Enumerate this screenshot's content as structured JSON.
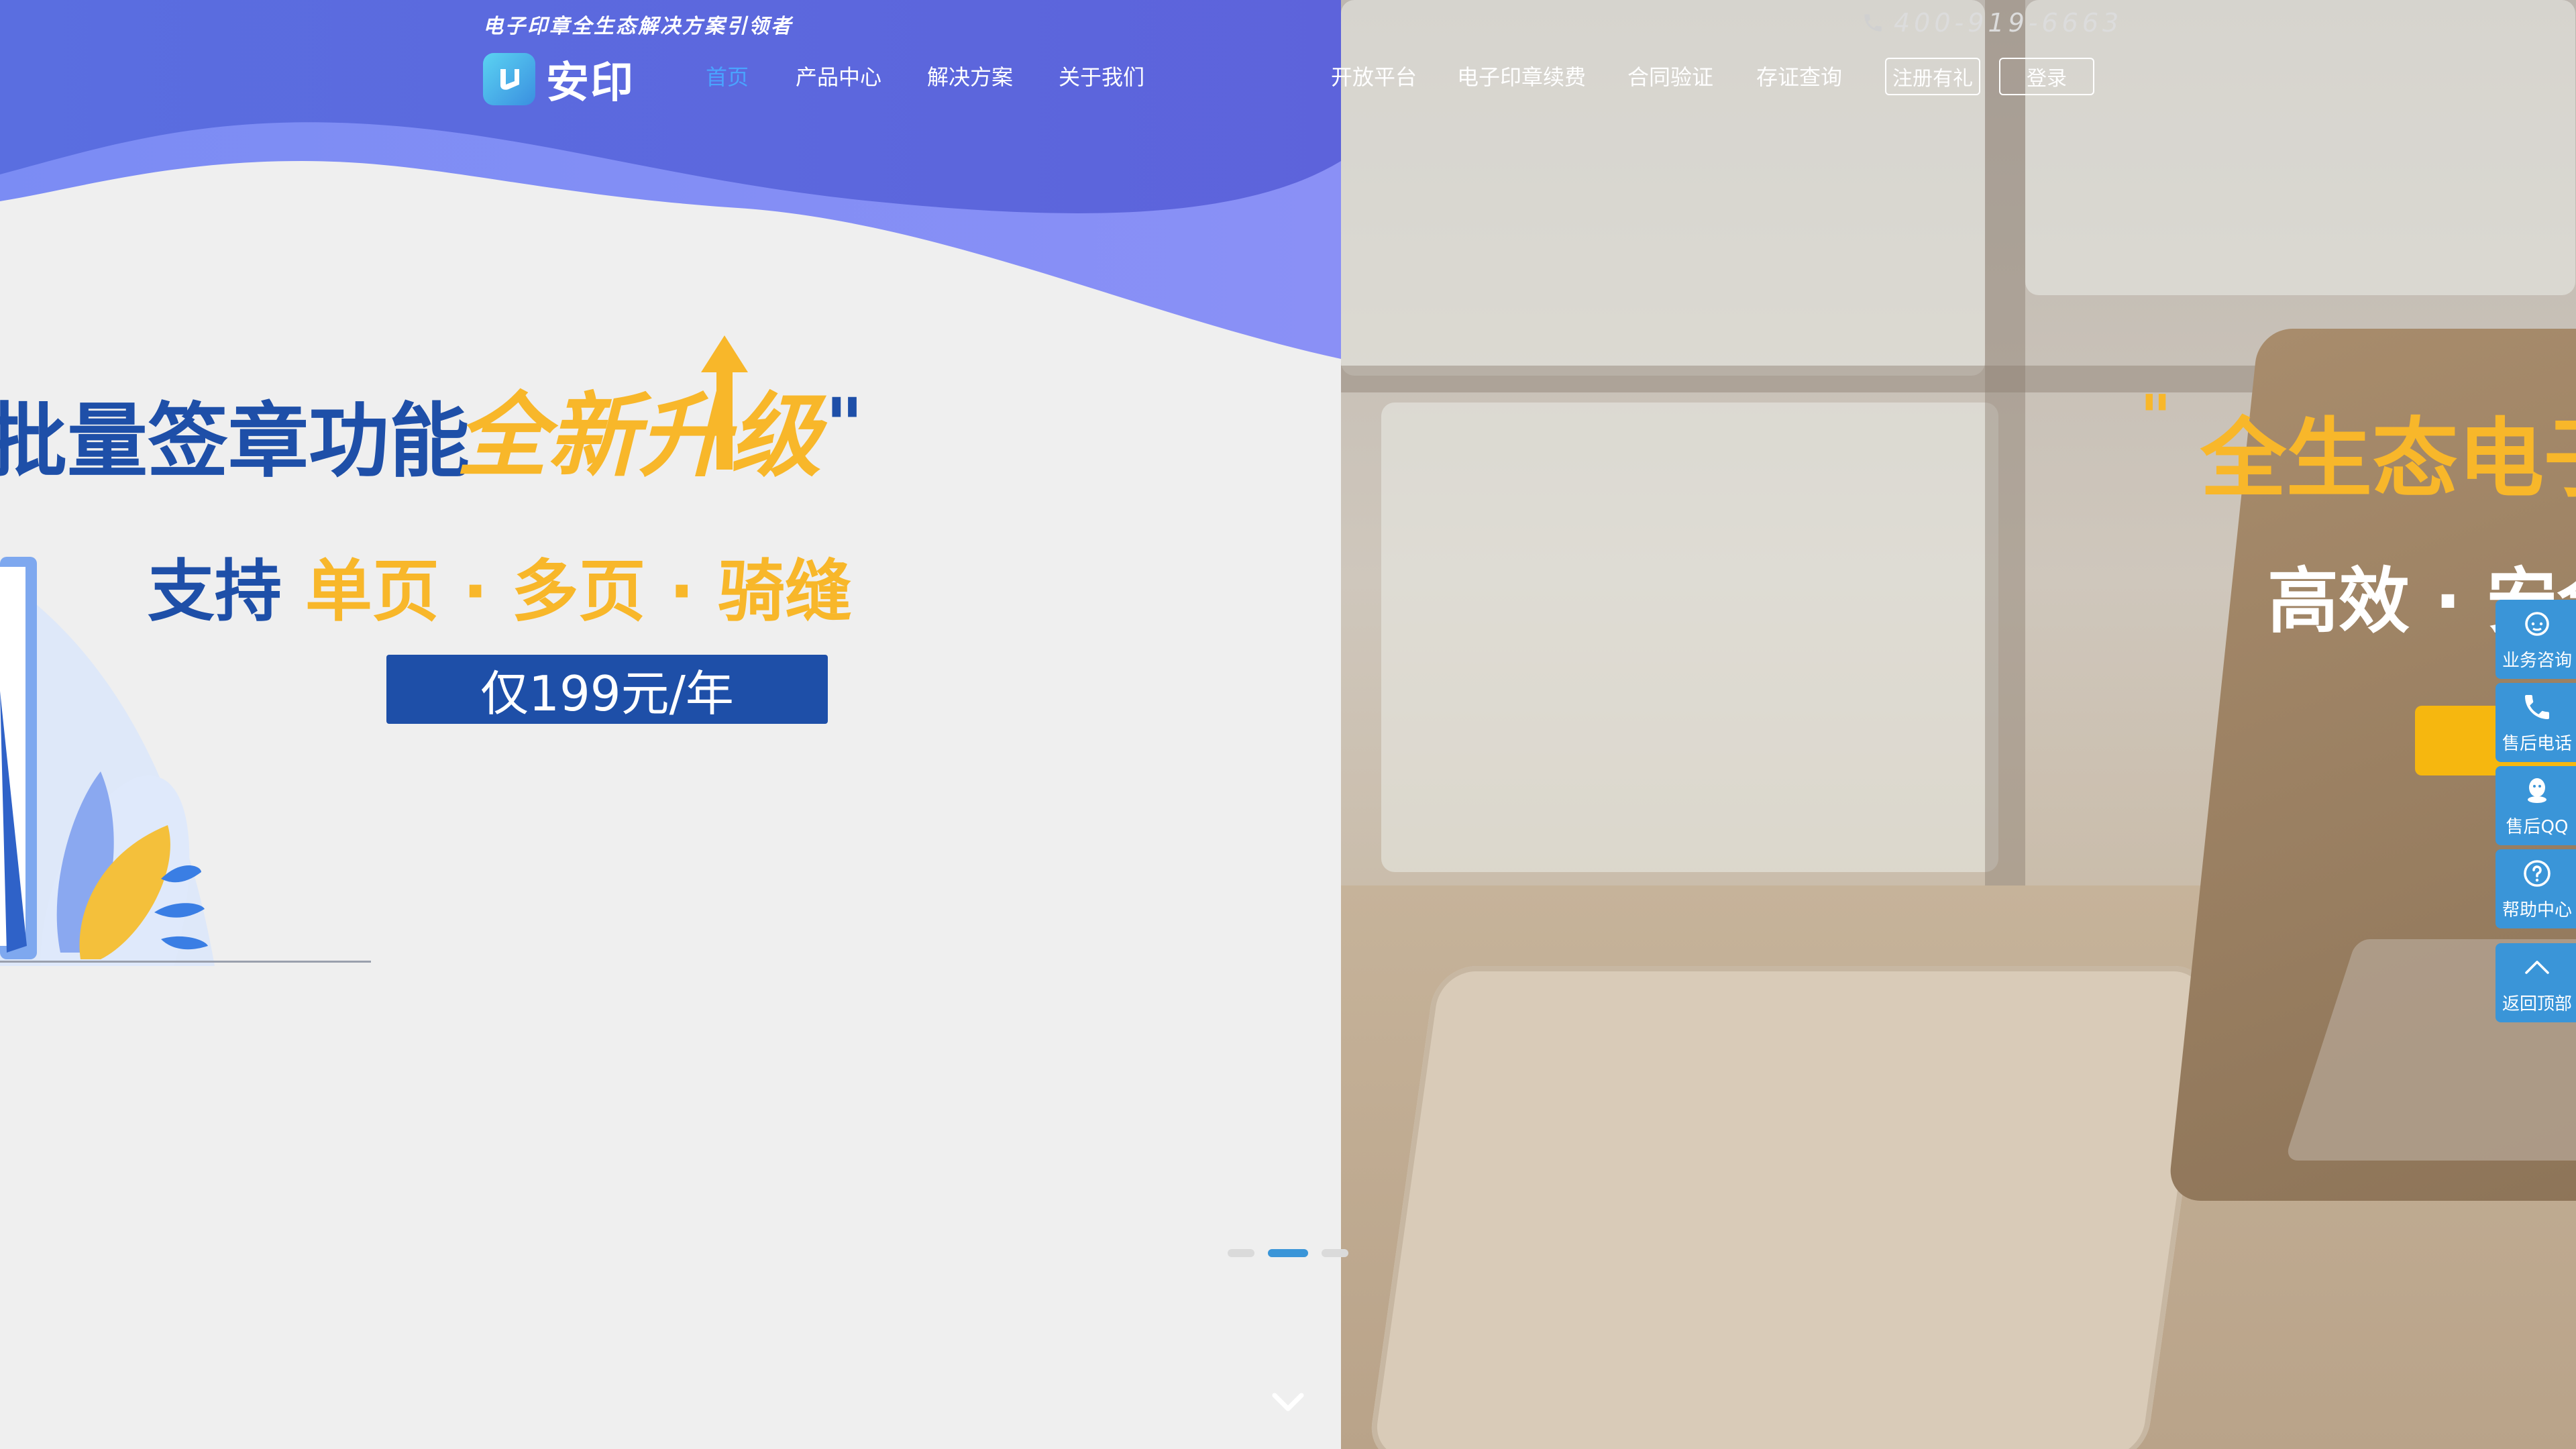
{
  "header": {
    "tagline": "电子印章全生态解决方案引领者",
    "phone": "400-919-6663",
    "logo_text": "安印",
    "nav_left": [
      "首页",
      "产品中心",
      "解决方案",
      "关于我们"
    ],
    "nav_right": [
      "开放平台",
      "电子印章续费",
      "合同验证",
      "存证查询"
    ],
    "register_label": "注册有礼",
    "login_label": "登录"
  },
  "slides": {
    "left": {
      "headline_main": "批量签章功能",
      "headline_accent": "全新升级",
      "quote_close": "\"",
      "sub_prefix": "支持",
      "sub_accent": "单页 · 多页 · 骑缝",
      "price": "仅199元/年"
    },
    "right": {
      "quote_open": "\"",
      "headline": "全生态电子",
      "sub": "高效 · 安全"
    }
  },
  "carousel": {
    "dot_count": 3,
    "active_index": 1
  },
  "float_bar": {
    "items": [
      "业务咨询",
      "售后电话",
      "售后QQ",
      "帮助中心",
      "返回顶部"
    ],
    "icons": [
      "headset-icon",
      "phone-icon",
      "qq-icon",
      "help-icon",
      "chevron-up-icon"
    ]
  },
  "colors": {
    "brand_blue": "#1e4fa8",
    "accent_yellow": "#f8b72a",
    "header_purple": "#5b67dc",
    "float_blue": "#3a95d8"
  }
}
